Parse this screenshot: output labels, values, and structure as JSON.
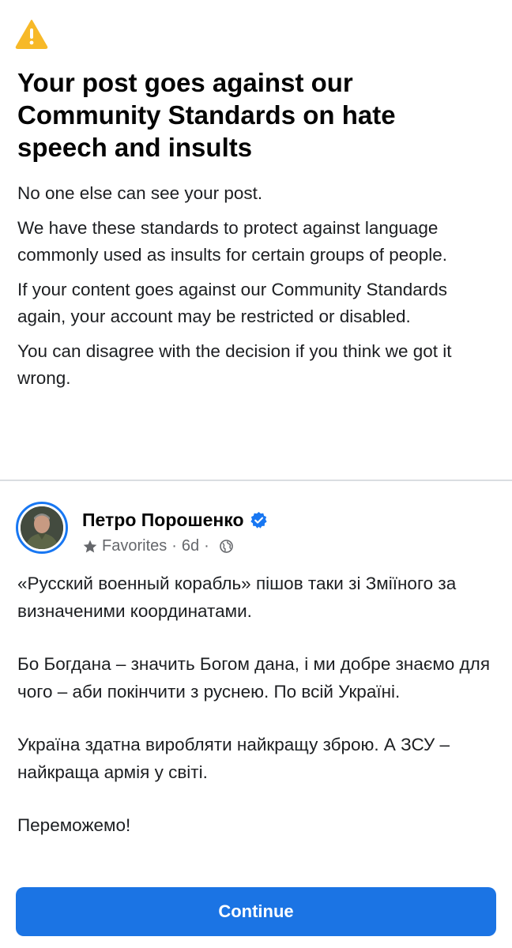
{
  "warning": {
    "icon": "warning-triangle-icon",
    "title": "Your post goes against our Community Standards on hate speech and insults",
    "paragraphs": [
      "No one else can see your post.",
      "We have these standards to protect against language commonly used as insults for certain groups of people.",
      "If your content goes against our Community Standards again, your account may be restricted or disabled.",
      "You can disagree with the decision if you think we got it wrong."
    ]
  },
  "post": {
    "author": "Петро Порошенко",
    "verified": true,
    "audience": "Favorites",
    "separator": "·",
    "time": "6d",
    "privacy_icon": "globe-icon",
    "paragraphs": [
      "«Русский военный корабль» пішов таки зі Зміїного за визначеними координатами.",
      "Бо Богдана – значить Богом дана, і ми добре знаємо для чого – аби покінчити з руснею. По всій Україні.",
      "Україна здатна виробляти найкращу зброю. А ЗСУ – найкраща армія у світі.",
      "Переможемо!"
    ]
  },
  "actions": {
    "continue_label": "Continue"
  },
  "colors": {
    "accent": "#1b74e4",
    "warning": "#f7b928",
    "verified": "#1877f2",
    "meta_text": "#65676b"
  }
}
